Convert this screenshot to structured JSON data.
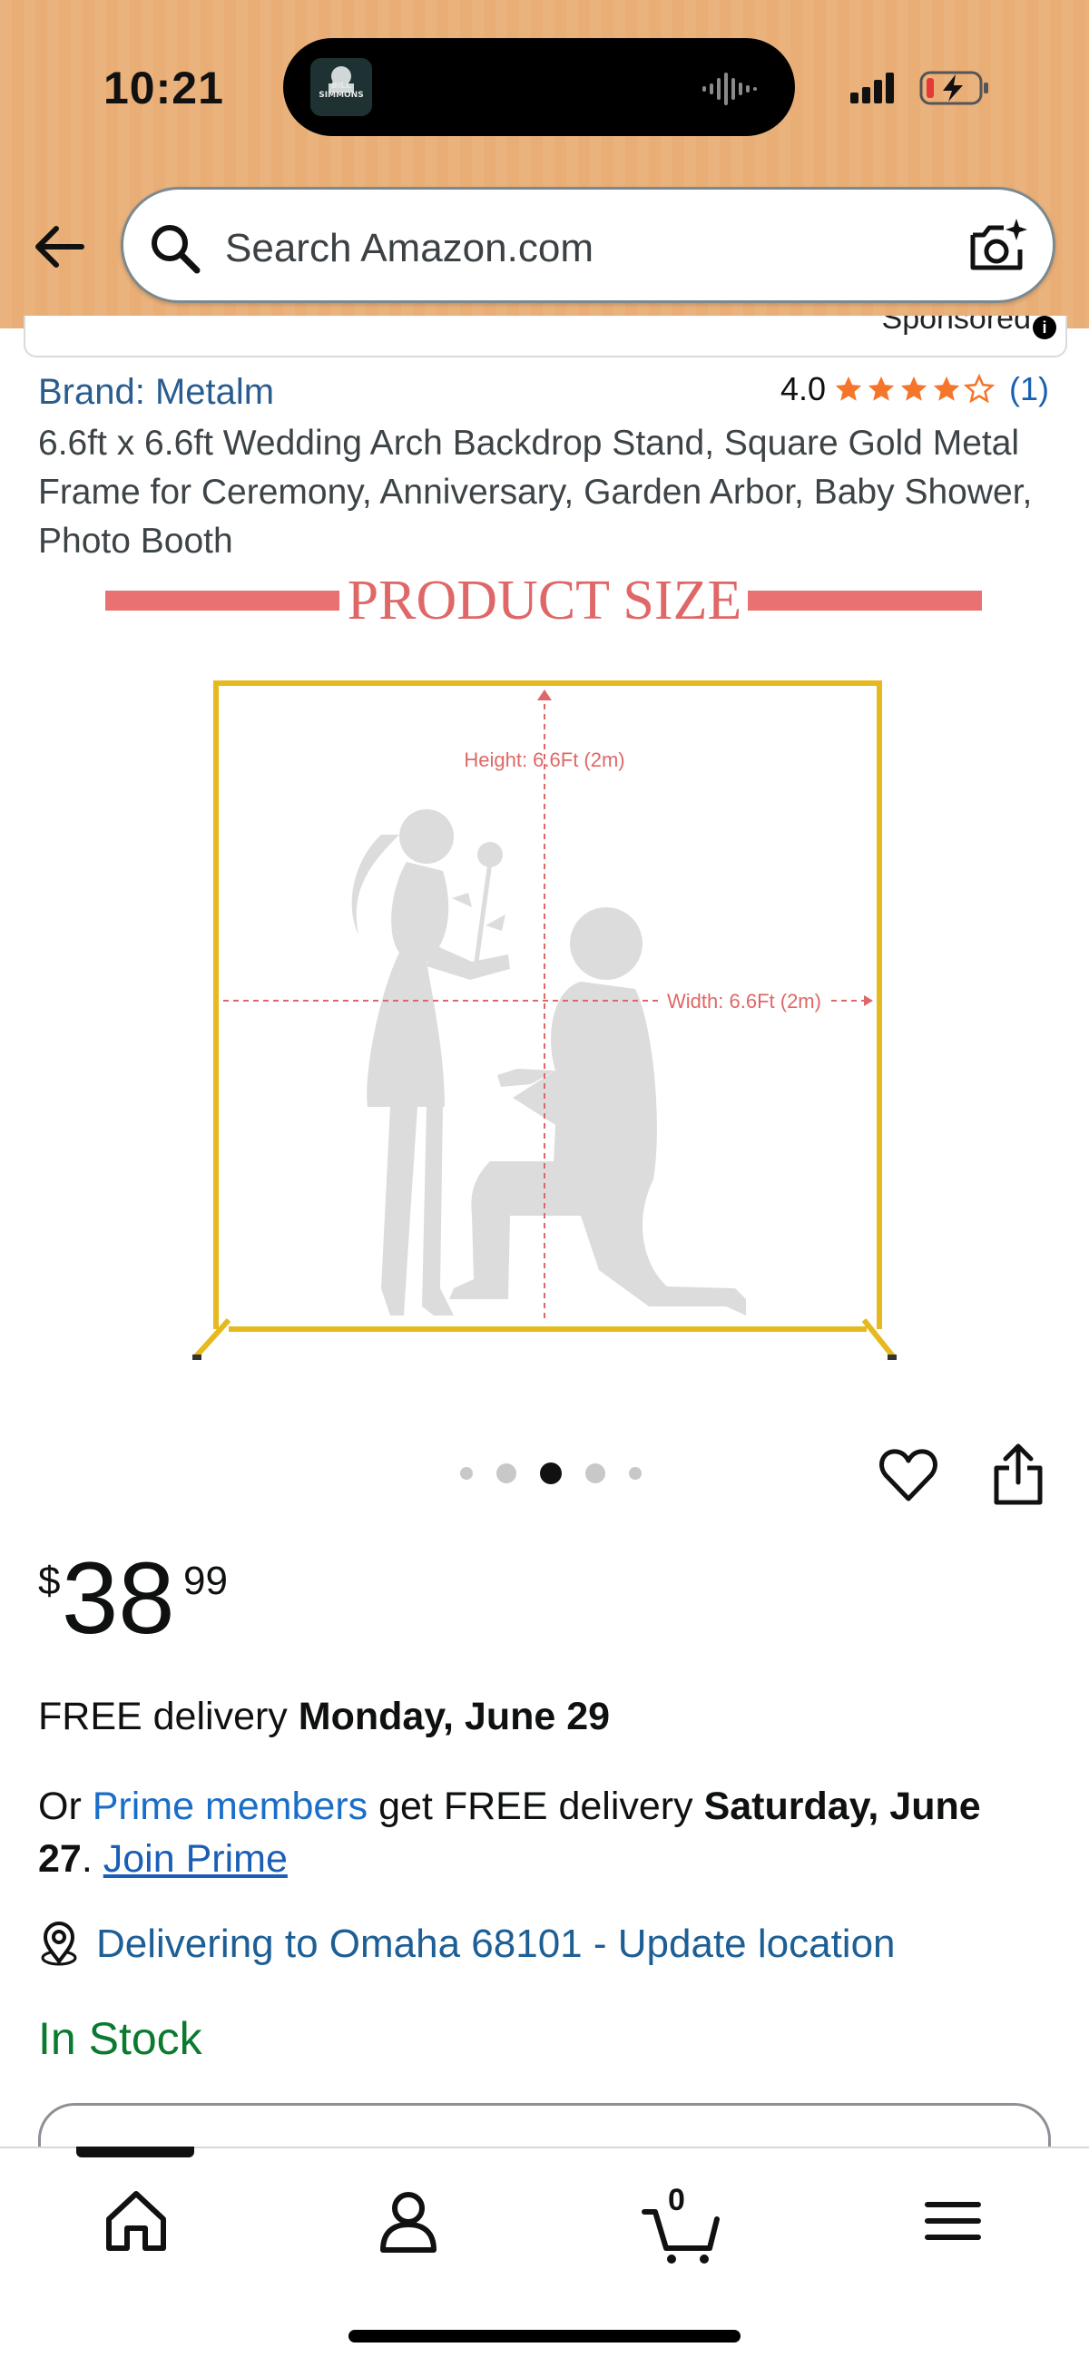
{
  "status_bar": {
    "time": "10:21",
    "now_playing_art_text": "BILL SIMMONS",
    "battery_state": "charging-low"
  },
  "search": {
    "placeholder": "Search Amazon.com"
  },
  "sponsored_label": "Sponsored",
  "product": {
    "brand": "Brand: Metalm",
    "rating_value": "4.0",
    "rating_stars": 4,
    "rating_count": "(1)",
    "title": "6.6ft x 6.6ft Wedding Arch Backdrop Stand, Square Gold Metal Frame for Ceremony, Anniversary, Garden Arbor, Baby Shower, Photo Booth"
  },
  "image": {
    "banner": "PRODUCT SIZE",
    "height_label": "Height: 6.6Ft (2m)",
    "width_label": "Width: 6.6Ft (2m)"
  },
  "carousel": {
    "count": 5,
    "active_index": 2
  },
  "price": {
    "symbol": "$",
    "whole": "38",
    "fraction": "99"
  },
  "delivery": {
    "prefix": "FREE delivery ",
    "date": "Monday, June 29"
  },
  "prime": {
    "prefix": "Or ",
    "members_link": "Prime members",
    "middle": " get FREE delivery ",
    "date": "Saturday, June 27",
    "after_date": ". ",
    "join_link": "Join Prime"
  },
  "location": {
    "text": "Delivering to Omaha 68101 - Update location"
  },
  "stock": "In Stock",
  "bottom_nav": {
    "items": [
      "home-icon",
      "account-icon",
      "cart-icon",
      "menu-icon"
    ],
    "cart_count": "0"
  },
  "colors": {
    "header_bg": "#eab27c",
    "link_blue": "#1a5fb4",
    "in_stock_green": "#0a7a2f",
    "star_orange": "#f5762a",
    "banner_red": "#e97171",
    "frame_gold": "#e6b91e"
  }
}
